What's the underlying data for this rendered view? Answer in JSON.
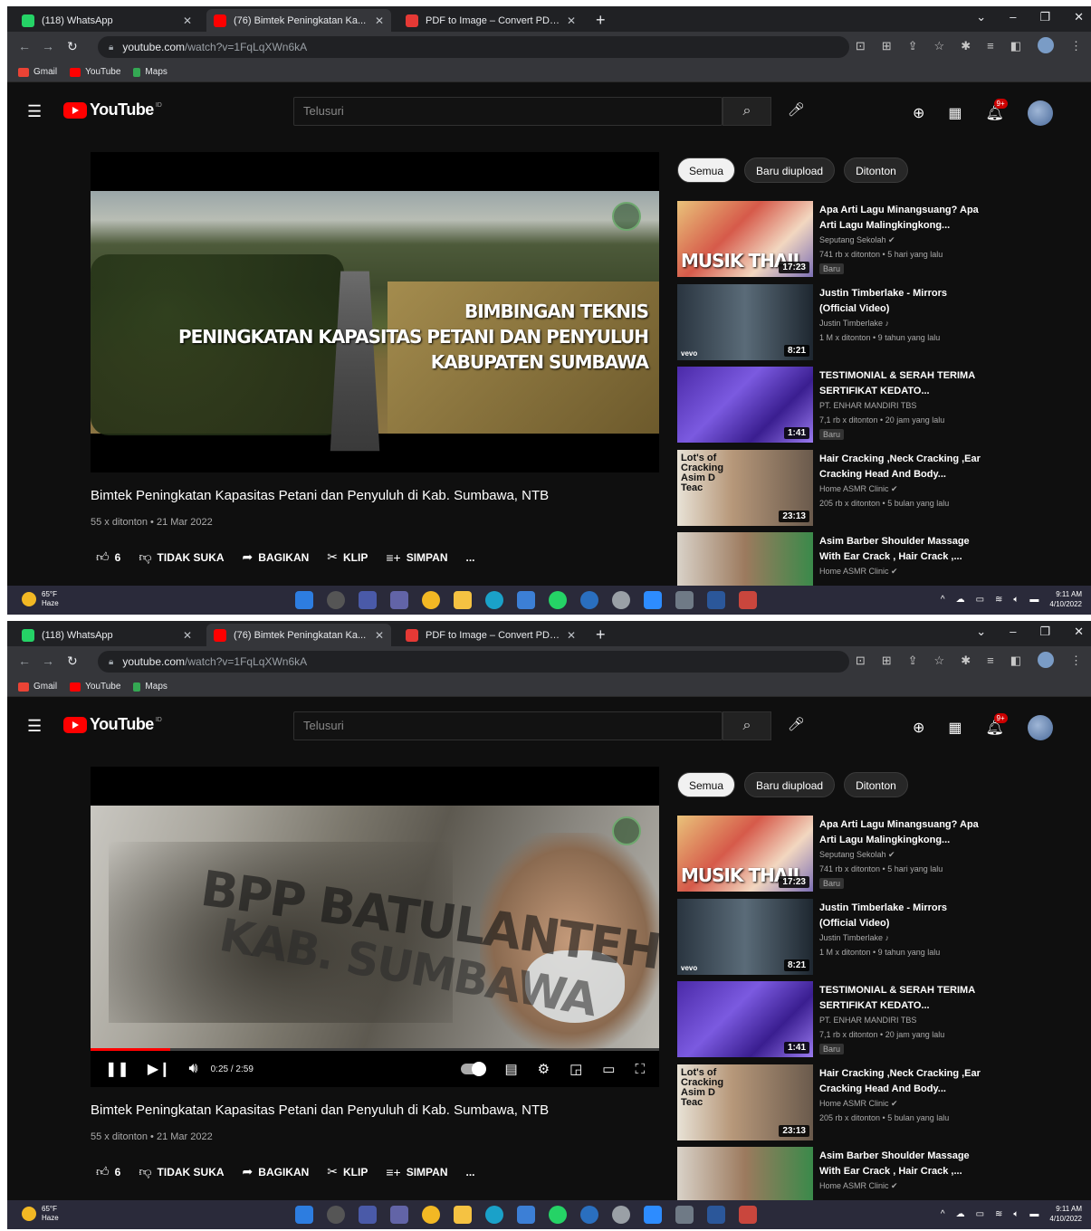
{
  "tabs": [
    {
      "title": "(118) WhatsApp",
      "color": "#25d366"
    },
    {
      "title": "(76) Bimtek Peningkatan Ka...",
      "color": "#ff0000"
    },
    {
      "title": "PDF to Image – Convert PDF to...",
      "color": "#e53935"
    }
  ],
  "address": {
    "domain": "youtube.com",
    "path": "/watch?v=1FqLqXWn6kA"
  },
  "bookmarks": [
    {
      "label": "Gmail",
      "color": "#ea4335"
    },
    {
      "label": "YouTube",
      "color": "#ff0000"
    },
    {
      "label": "Maps",
      "color": "#34a853"
    }
  ],
  "youtube": {
    "logo": "YouTube",
    "logo_sup": "ID",
    "search_placeholder": "Telusuri",
    "notif_badge": "9+"
  },
  "video": {
    "overlay_lines": [
      "BIMBINGAN TEKNIS",
      "PENINGKATAN KAPASITAS PETANI DAN PENYULUH",
      "KABUPATEN SUMBAWA"
    ],
    "frame2_text_line1": "BPP BATULANTEH",
    "frame2_text_line2": "KAB. SUMBAWA",
    "title": "Bimtek Peningkatan Kapasitas Petani dan Penyuluh di Kab. Sumbawa, NTB",
    "meta": "55 x ditonton • 21 Mar 2022",
    "time": "0:25 / 2:59",
    "progress": 0.14,
    "likes": "6",
    "dislike": "TIDAK SUKA",
    "share": "BAGIKAN",
    "clip": "KLIP",
    "save": "SIMPAN",
    "more": "..."
  },
  "chips": [
    "Semua",
    "Baru diupload",
    "Ditonton"
  ],
  "recommendations": [
    {
      "title": "Apa Arti Lagu Minangsuang? Apa Arti Lagu Malingkingkong...",
      "channel": "Seputang Sekolah ✔",
      "views": "741 rb x ditonton • 5 hari yang lalu",
      "badge": "Baru",
      "duration": "17:23",
      "thumb_label": "MUSIK THAIL"
    },
    {
      "title": "Justin Timberlake - Mirrors (Official Video)",
      "channel": "Justin Timberlake ♪",
      "views": "1 M x ditonton • 9 tahun yang lalu",
      "badge": "",
      "duration": "8:21",
      "thumb_label": "vevo"
    },
    {
      "title": "TESTIMONIAL & SERAH TERIMA SERTIFIKAT KEDATO...",
      "channel": "PT. ENHAR MANDIRI TBS",
      "views": "7,1 rb x ditonton • 20 jam yang lalu",
      "badge": "Baru",
      "duration": "1:41",
      "thumb_label": ""
    },
    {
      "title": "Hair Cracking ,Neck Cracking ,Ear Cracking Head And Body...",
      "channel": "Home ASMR Clinic ✔",
      "views": "205 rb x ditonton • 5 bulan yang lalu",
      "badge": "",
      "duration": "23:13",
      "thumb_label": "Lot's of Cracking Asim D Teac"
    },
    {
      "title": "Asim Barber Shoulder Massage With Ear Crack , Hair Crack ,...",
      "channel": "Home ASMR Clinic ✔",
      "views": "",
      "badge": "",
      "duration": "",
      "thumb_label": ""
    }
  ],
  "taskbar": {
    "temp": "65°F",
    "weather": "Haze",
    "time": "9:11 AM",
    "date": "4/10/2022"
  }
}
